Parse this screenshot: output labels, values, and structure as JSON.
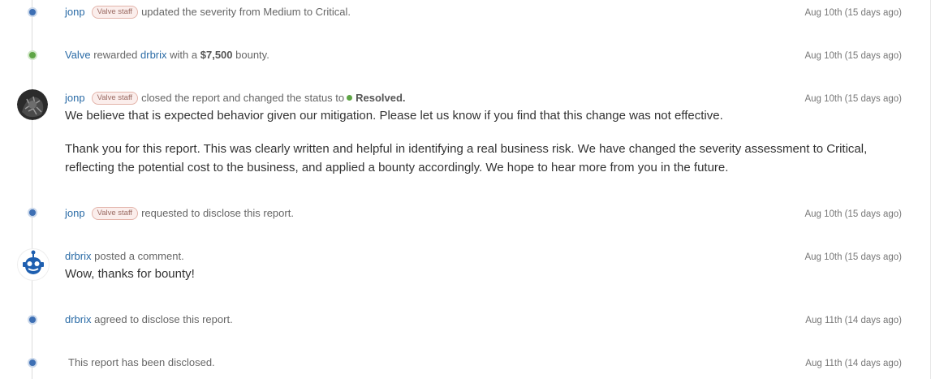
{
  "staff_badge": "Valve staff",
  "events": [
    {
      "user": "jonp",
      "badge": true,
      "text": "updated the severity from Medium to Critical.",
      "date": "Aug 10th (15 days ago)"
    },
    {
      "user": "Valve",
      "text_a": "rewarded",
      "target": "drbrix",
      "text_b": "with a",
      "amount": "$7,500",
      "text_c": "bounty.",
      "date": "Aug 10th (15 days ago)"
    },
    {
      "user": "jonp",
      "badge": true,
      "text": "closed the report and changed the status to",
      "status": "Resolved.",
      "date": "Aug 10th (15 days ago)",
      "comment": [
        "We believe that is expected behavior given our mitigation. Please let us know if you find that this change was not effective.",
        "Thank you for this report. This was clearly written and helpful in identifying a real business risk. We have changed the severity assessment to Critical, reflecting the potential cost to the business, and applied a bounty accordingly. We hope to hear more from you in the future."
      ]
    },
    {
      "user": "jonp",
      "badge": true,
      "text": "requested to disclose this report.",
      "date": "Aug 10th (15 days ago)"
    },
    {
      "user": "drbrix",
      "text": "posted a comment.",
      "date": "Aug 10th (15 days ago)",
      "comment": [
        "Wow, thanks for bounty!"
      ]
    },
    {
      "user": "drbrix",
      "text": "agreed to disclose this report.",
      "date": "Aug 11th (14 days ago)"
    },
    {
      "text": "This report has been disclosed.",
      "date": "Aug 11th (14 days ago)"
    }
  ],
  "colors": {
    "link": "#2a6ba6",
    "dot_blue": "#3d6fb4",
    "dot_green": "#5ea545",
    "badge_border": "#e3b4aa"
  },
  "icons": {
    "jonp_avatar": "user-photo-avatar",
    "drbrix_avatar": "robot-avatar"
  }
}
